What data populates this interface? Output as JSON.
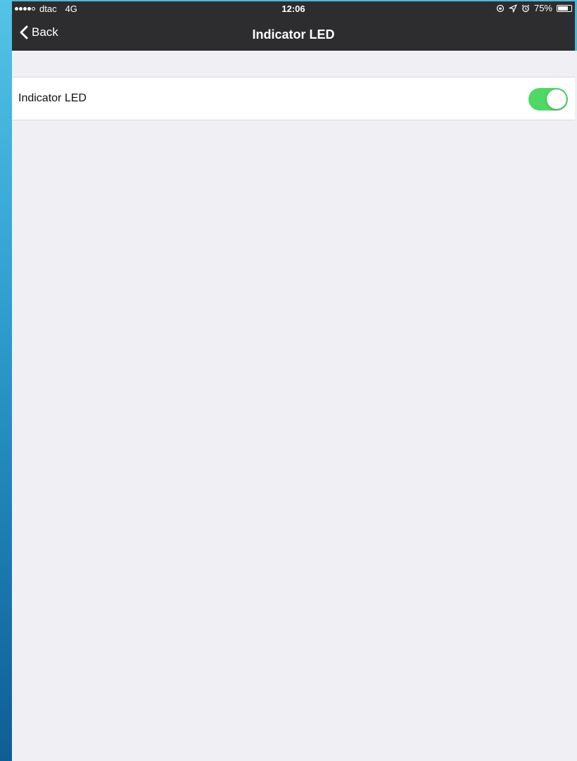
{
  "status_bar": {
    "carrier": "dtac",
    "network": "4G",
    "time": "12:06",
    "battery": "75%",
    "battery_level": 0.75,
    "icons": [
      "signal-dots-icon",
      "lock-rotation-icon",
      "location-icon",
      "alarm-icon",
      "battery-icon"
    ]
  },
  "nav": {
    "back_label": "Back",
    "title": "Indicator LED"
  },
  "settings": {
    "items": [
      {
        "label": "Indicator LED",
        "enabled": true
      }
    ]
  },
  "colors": {
    "header_bg": "#2d2d2f",
    "page_bg": "#f0eff4",
    "toggle_on": "#4cd964"
  }
}
